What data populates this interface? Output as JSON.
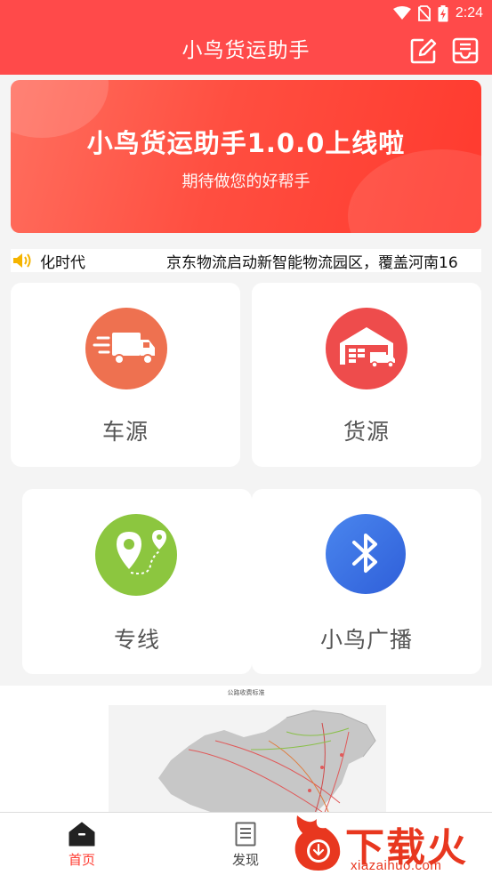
{
  "status_bar": {
    "time": "2:24",
    "icons": [
      "wifi-icon",
      "no-sim-icon",
      "battery-charging-icon"
    ]
  },
  "app_bar": {
    "title": "小鸟货运助手",
    "actions": [
      "edit-icon",
      "inbox-icon"
    ]
  },
  "banner": {
    "title": "小鸟货运助手1.0.0上线啦",
    "subtitle": "期待做您的好帮手"
  },
  "ticker": {
    "icon": "speaker-icon",
    "items": [
      "化时代",
      "京东物流启动新智能物流园区，覆盖河南16"
    ]
  },
  "features": [
    {
      "label": "车源",
      "icon": "truck-icon",
      "color": "#ee7150"
    },
    {
      "label": "货源",
      "icon": "warehouse-icon",
      "color": "#ee4c4c"
    },
    {
      "label": "专线",
      "icon": "location-pin-icon",
      "color": "#8cc63f"
    },
    {
      "label": "小鸟广播",
      "icon": "bluetooth-icon",
      "color": "#3a6fe0"
    }
  ],
  "map_section": {
    "caption": "公路收费标准"
  },
  "tab_bar": {
    "tabs": [
      {
        "label": "首页",
        "icon": "home-icon",
        "active": true
      },
      {
        "label": "发现",
        "icon": "document-icon",
        "active": false
      }
    ],
    "active_color": "#ff3b30"
  },
  "watermark": {
    "text": "下载火",
    "url": "xiazaihuo.com",
    "icon": "flame-download-icon"
  },
  "colors": {
    "primary": "#ff4a4a"
  }
}
